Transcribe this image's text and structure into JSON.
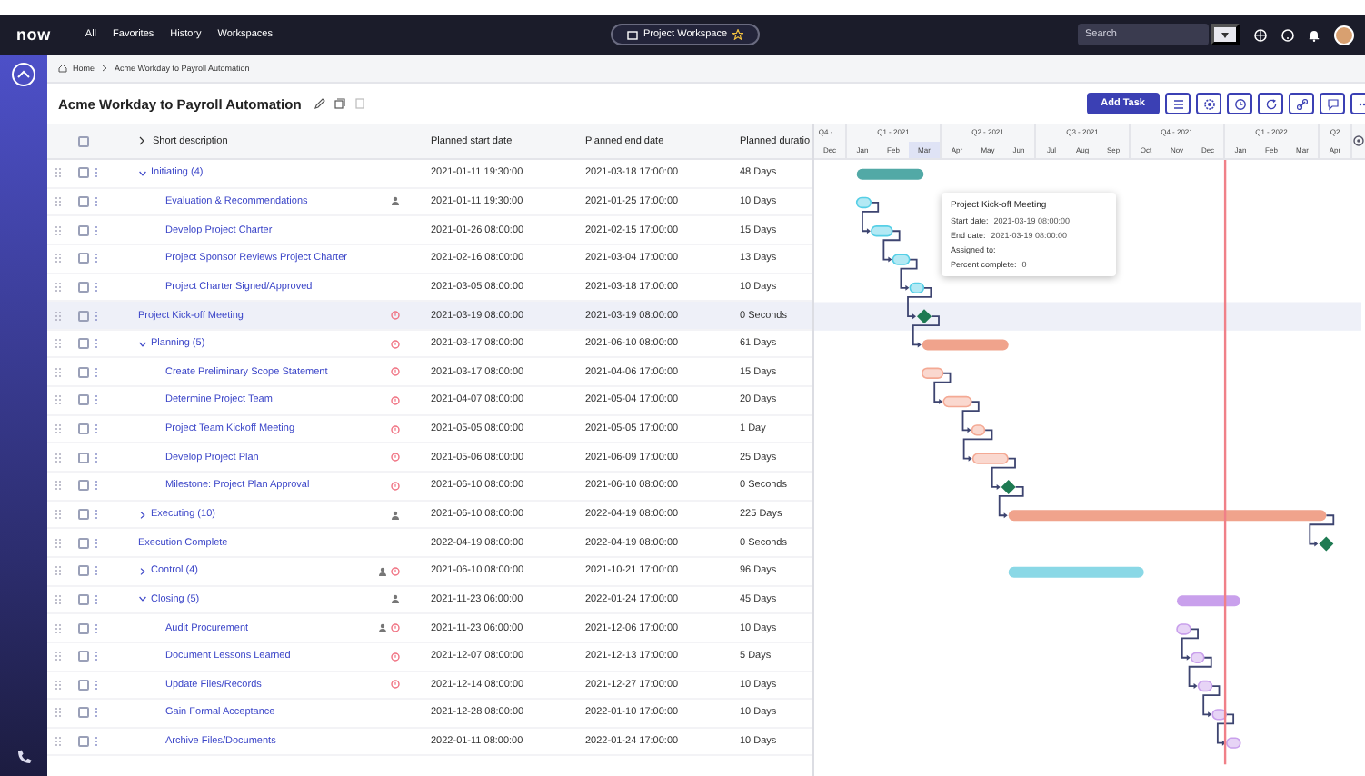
{
  "nav": {
    "logo": "now",
    "links": [
      {
        "label": "All"
      },
      {
        "label": "Favorites"
      },
      {
        "label": "History"
      },
      {
        "label": "Workspaces"
      }
    ],
    "workspace": {
      "label": "Project Workspace"
    },
    "search": {
      "placeholder": "Search"
    }
  },
  "breadcrumb": [
    {
      "label": "Home"
    },
    {
      "label": "Acme Workday to Payroll Automation"
    }
  ],
  "page": {
    "title": "Acme Workday to Payroll Automation",
    "add_button": "Add Task"
  },
  "table": {
    "header_checked": false,
    "columns": [
      {
        "label": "Short description"
      },
      {
        "label": "Planned start date"
      },
      {
        "label": "Planned end date"
      },
      {
        "label": "Planned duratio"
      }
    ],
    "rows": [
      {
        "name": "Initiating (4)",
        "kind": "summary",
        "color": "#52a9a6",
        "expanded": true,
        "checked": false,
        "highlighted": false,
        "linked": false,
        "start": "2021-01-11 19:30:00",
        "end": "2021-03-18 17:00:00",
        "duration": "48 Days",
        "children": [
          {
            "name": "Evaluation & Recommendations",
            "kind": "task",
            "color": "#56cfe6",
            "checked": false,
            "highlighted": false,
            "linked": false,
            "indicators": [
              {
                "kind": "user"
              }
            ],
            "start": "2021-01-11 19:30:00",
            "end": "2021-01-25 17:00:00",
            "duration": "10 Days"
          },
          {
            "name": "Develop Project Charter",
            "kind": "task",
            "color": "#56cfe6",
            "checked": false,
            "highlighted": false,
            "linked": true,
            "start": "2021-01-26 08:00:00",
            "end": "2021-02-15 17:00:00",
            "duration": "15 Days"
          },
          {
            "name": "Project Sponsor Reviews Project Charter",
            "kind": "task",
            "color": "#56cfe6",
            "checked": false,
            "highlighted": false,
            "linked": true,
            "start": "2021-02-16 08:00:00",
            "end": "2021-03-04 17:00:00",
            "duration": "13 Days"
          },
          {
            "name": "Project Charter Signed/Approved",
            "kind": "task",
            "color": "#56cfe6",
            "checked": false,
            "highlighted": false,
            "linked": true,
            "start": "2021-03-05 08:00:00",
            "end": "2021-03-18 17:00:00",
            "duration": "10 Days"
          }
        ]
      },
      {
        "name": "Project Kick-off Meeting",
        "kind": "milestone",
        "color": "#1e7a52",
        "checked": false,
        "highlighted": true,
        "linked": true,
        "indicators": [
          {
            "kind": "alert"
          }
        ],
        "start": "2021-03-19 08:00:00",
        "end": "2021-03-19 08:00:00",
        "duration": "0 Seconds"
      },
      {
        "name": "Planning (5)",
        "kind": "summary",
        "color": "#f0a38c",
        "expanded": true,
        "checked": false,
        "highlighted": false,
        "linked": true,
        "indicators": [
          {
            "kind": "alert"
          }
        ],
        "start": "2021-03-17 08:00:00",
        "end": "2021-06-10 08:00:00",
        "duration": "61 Days",
        "children": [
          {
            "name": "Create Preliminary Scope Statement",
            "kind": "task",
            "color": "#f4a994",
            "checked": false,
            "highlighted": false,
            "linked": false,
            "indicators": [
              {
                "kind": "alert"
              }
            ],
            "start": "2021-03-17 08:00:00",
            "end": "2021-04-06 17:00:00",
            "duration": "15 Days"
          },
          {
            "name": "Determine Project Team",
            "kind": "task",
            "color": "#f4a994",
            "checked": false,
            "highlighted": false,
            "linked": true,
            "indicators": [
              {
                "kind": "alert"
              }
            ],
            "start": "2021-04-07 08:00:00",
            "end": "2021-05-04 17:00:00",
            "duration": "20 Days"
          },
          {
            "name": "Project Team Kickoff Meeting",
            "kind": "task",
            "color": "#f4a994",
            "checked": false,
            "highlighted": false,
            "linked": true,
            "indicators": [
              {
                "kind": "alert"
              }
            ],
            "start": "2021-05-05 08:00:00",
            "end": "2021-05-05 17:00:00",
            "duration": "1 Day"
          },
          {
            "name": "Develop Project Plan",
            "kind": "task",
            "color": "#f4a994",
            "checked": false,
            "highlighted": false,
            "linked": true,
            "indicators": [
              {
                "kind": "alert"
              }
            ],
            "start": "2021-05-06 08:00:00",
            "end": "2021-06-09 17:00:00",
            "duration": "25 Days"
          },
          {
            "name": "Milestone: Project Plan Approval",
            "kind": "milestone",
            "color": "#1e7a52",
            "checked": false,
            "highlighted": false,
            "linked": true,
            "indicators": [
              {
                "kind": "alert"
              }
            ],
            "start": "2021-06-10 08:00:00",
            "end": "2021-06-10 08:00:00",
            "duration": "0 Seconds"
          }
        ]
      },
      {
        "name": "Executing (10)",
        "kind": "summary",
        "color": "#f0a38c",
        "expanded": false,
        "checked": false,
        "highlighted": false,
        "linked": true,
        "indicators": [
          {
            "kind": "user"
          }
        ],
        "start": "2021-06-10 08:00:00",
        "end": "2022-04-19 08:00:00",
        "duration": "225 Days"
      },
      {
        "name": "Execution Complete",
        "kind": "milestone",
        "color": "#1e7a52",
        "checked": false,
        "highlighted": false,
        "linked": true,
        "start": "2022-04-19 08:00:00",
        "end": "2022-04-19 08:00:00",
        "duration": "0 Seconds"
      },
      {
        "name": "Control (4)",
        "kind": "summary",
        "color": "#8ad8e6",
        "expanded": false,
        "checked": false,
        "highlighted": false,
        "linked": false,
        "indicators": [
          {
            "kind": "user"
          },
          {
            "kind": "alert"
          }
        ],
        "start": "2021-06-10 08:00:00",
        "end": "2021-10-21 17:00:00",
        "duration": "96 Days"
      },
      {
        "name": "Closing (5)",
        "kind": "summary",
        "color": "#c9a0ec",
        "expanded": true,
        "checked": false,
        "highlighted": false,
        "linked": false,
        "indicators": [
          {
            "kind": "user"
          }
        ],
        "start": "2021-11-23 06:00:00",
        "end": "2022-01-24 17:00:00",
        "duration": "45 Days",
        "children": [
          {
            "name": "Audit Procurement",
            "kind": "task",
            "color": "#c9a0ec",
            "checked": false,
            "highlighted": false,
            "linked": false,
            "indicators": [
              {
                "kind": "user"
              },
              {
                "kind": "alert"
              }
            ],
            "start": "2021-11-23 06:00:00",
            "end": "2021-12-06 17:00:00",
            "duration": "10 Days"
          },
          {
            "name": "Document Lessons Learned",
            "kind": "task",
            "color": "#c9a0ec",
            "checked": false,
            "highlighted": false,
            "linked": true,
            "indicators": [
              {
                "kind": "alert"
              }
            ],
            "start": "2021-12-07 08:00:00",
            "end": "2021-12-13 17:00:00",
            "duration": "5 Days"
          },
          {
            "name": "Update Files/Records",
            "kind": "task",
            "color": "#c9a0ec",
            "checked": false,
            "highlighted": false,
            "linked": true,
            "indicators": [
              {
                "kind": "alert"
              }
            ],
            "start": "2021-12-14 08:00:00",
            "end": "2021-12-27 17:00:00",
            "duration": "10 Days"
          },
          {
            "name": "Gain Formal Acceptance",
            "kind": "task",
            "color": "#c9a0ec",
            "checked": false,
            "highlighted": false,
            "linked": true,
            "start": "2021-12-28 08:00:00",
            "end": "2022-01-10 17:00:00",
            "duration": "10 Days"
          },
          {
            "name": "Archive Files/Documents",
            "kind": "task",
            "color": "#c9a0ec",
            "checked": false,
            "highlighted": false,
            "linked": true,
            "start": "2022-01-11 08:00:00",
            "end": "2022-01-24 17:00:00",
            "duration": "10 Days"
          }
        ]
      }
    ]
  },
  "gantt": {
    "quarters": [
      {
        "label": "Q4 - ...",
        "months": [
          {
            "label": "Dec",
            "highlighted": false
          }
        ]
      },
      {
        "label": "Q1 - 2021",
        "months": [
          {
            "label": "Jan",
            "highlighted": false
          },
          {
            "label": "Feb",
            "highlighted": false
          },
          {
            "label": "Mar",
            "highlighted": true
          }
        ]
      },
      {
        "label": "Q2 - 2021",
        "months": [
          {
            "label": "Apr",
            "highlighted": false
          },
          {
            "label": "May",
            "highlighted": false
          },
          {
            "label": "Jun",
            "highlighted": false
          }
        ]
      },
      {
        "label": "Q3 - 2021",
        "months": [
          {
            "label": "Jul",
            "highlighted": false
          },
          {
            "label": "Aug",
            "highlighted": false
          },
          {
            "label": "Sep",
            "highlighted": false
          }
        ]
      },
      {
        "label": "Q4 - 2021",
        "months": [
          {
            "label": "Oct",
            "highlighted": false
          },
          {
            "label": "Nov",
            "highlighted": false
          },
          {
            "label": "Dec",
            "highlighted": false
          }
        ]
      },
      {
        "label": "Q1 - 2022",
        "months": [
          {
            "label": "Jan",
            "highlighted": false
          },
          {
            "label": "Feb",
            "highlighted": false
          },
          {
            "label": "Mar",
            "highlighted": false
          }
        ]
      },
      {
        "label": "Q2",
        "months": [
          {
            "label": "Apr",
            "highlighted": false
          }
        ]
      }
    ],
    "today_marker": {
      "level": 0.751
    },
    "tooltip": {
      "title": "Project Kick-off Meeting",
      "fields": [
        {
          "label": "Start date:",
          "value": "2021-03-19 08:00:00"
        },
        {
          "label": "End date:",
          "value": "2021-03-19 08:00:00"
        },
        {
          "label": "Assigned to:"
        },
        {
          "label": "Percent complete:",
          "value": "0"
        }
      ]
    }
  }
}
